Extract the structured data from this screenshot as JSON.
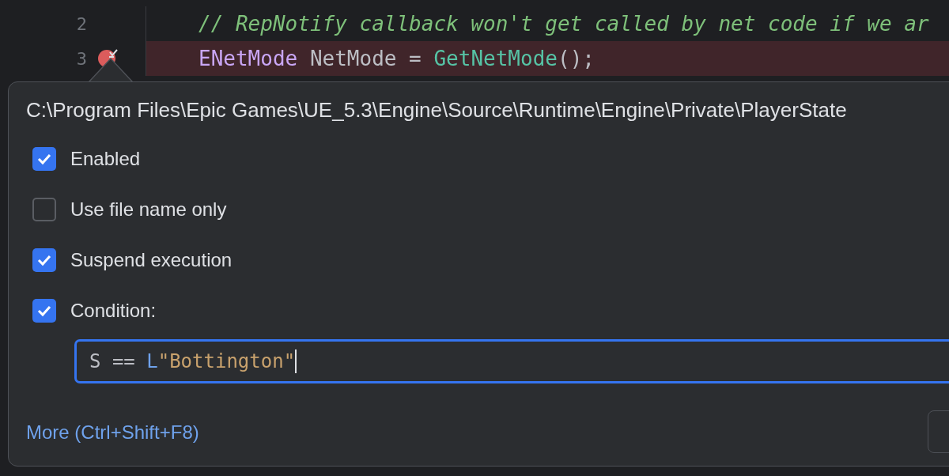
{
  "editor": {
    "lines": [
      {
        "number": "2",
        "breakpoint": false,
        "tokens": [
          {
            "kind": "comment",
            "text": "// RepNotify callback won't get called by net code if we ar"
          }
        ]
      },
      {
        "number": "3",
        "breakpoint": true,
        "tokens": [
          {
            "kind": "type",
            "text": "ENetMode"
          },
          {
            "kind": "variable",
            "text": " NetMode"
          },
          {
            "kind": "plain",
            "text": " = "
          },
          {
            "kind": "function",
            "text": "GetNetMode"
          },
          {
            "kind": "plain",
            "text": "();"
          }
        ]
      }
    ]
  },
  "breakpoint_popup": {
    "title": "C:\\Program Files\\Epic Games\\UE_5.3\\Engine\\Source\\Runtime\\Engine\\Private\\PlayerState",
    "options": [
      {
        "label": "Enabled",
        "checked": true
      },
      {
        "label": "Use file name only",
        "checked": false
      },
      {
        "label": "Suspend execution",
        "checked": true
      },
      {
        "label": "Condition:",
        "checked": true
      }
    ],
    "condition": {
      "tokens": [
        {
          "kind": "plain",
          "text": "S == "
        },
        {
          "kind": "prefix",
          "text": "L"
        },
        {
          "kind": "string",
          "text": "\"Bottington\""
        }
      ]
    },
    "more_link": "More (Ctrl+Shift+F8)"
  }
}
